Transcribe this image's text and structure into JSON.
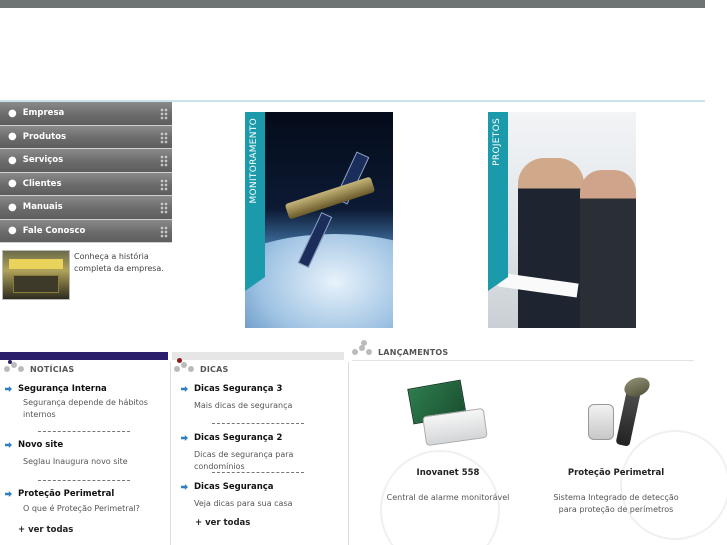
{
  "nav": {
    "items": [
      {
        "label": "Empresa"
      },
      {
        "label": "Produtos"
      },
      {
        "label": "Serviços"
      },
      {
        "label": "Clientes"
      },
      {
        "label": "Manuais"
      },
      {
        "label": "Fale Conosco"
      }
    ],
    "bullet": "●"
  },
  "company": {
    "text": "Conheça a história completa da empresa."
  },
  "banners": {
    "monitoramento": "MONITORAMENTO",
    "projetos": "PROJETOS"
  },
  "noticias": {
    "title": "NOTÍCIAS",
    "items": [
      {
        "title": "Segurança Interna",
        "desc": "Segurança depende de hábitos internos"
      },
      {
        "title": "Novo site",
        "desc": "Seglau Inaugura novo site"
      },
      {
        "title": "Proteção Perimetral",
        "desc": "O que é Proteção Perimetral?"
      }
    ],
    "separator": "------------------------------------",
    "more": "+ ver todas"
  },
  "dicas": {
    "title": "DICAS",
    "items": [
      {
        "title": "Dicas Segurança 3",
        "desc": "Mais dicas de segurança"
      },
      {
        "title": "Dicas Segurança 2",
        "desc": "Dicas de segurança para condomínios"
      },
      {
        "title": "Dicas Segurança",
        "desc": "Veja dicas para sua casa"
      }
    ],
    "separator": "------------------------------------",
    "more": "+ ver todas"
  },
  "lancamentos": {
    "title": "LANÇAMENTOS",
    "products": [
      {
        "name": "Inovanet 558",
        "desc": "Central de alarme monitorável"
      },
      {
        "name": "Proteção Perimetral",
        "desc": "Sistema Integrado de detecção para proteção de perímetros"
      }
    ]
  },
  "colors": {
    "accent_teal": "#1b9aac",
    "noticias_bar": "#2a1f6b",
    "nav_bg": "#6b6b6b",
    "link_arrow": "#2f7fc6"
  }
}
